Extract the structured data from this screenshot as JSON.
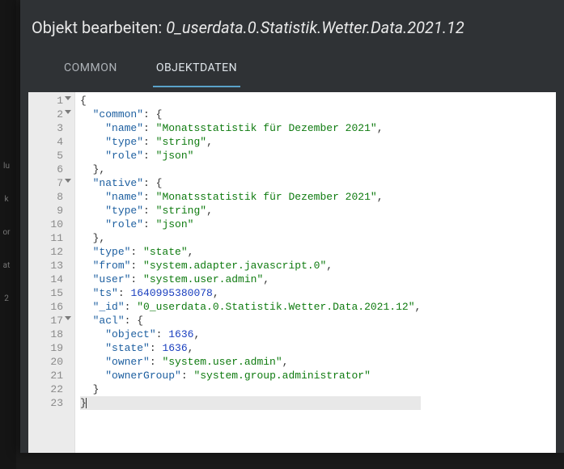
{
  "title_prefix": "Objekt bearbeiten: ",
  "object_id": "0_userdata.0.Statistik.Wetter.Data.2021.12",
  "tabs": {
    "common": "COMMON",
    "objektdaten": "OBJEKTDATEN"
  },
  "side_hints": [
    "lu",
    "k",
    "or",
    "at",
    "2"
  ],
  "editor": {
    "line_count": 23,
    "fold_lines": [
      1,
      2,
      7,
      17
    ],
    "content": {
      "common": {
        "name": "Monatsstatistik für Dezember 2021",
        "type": "string",
        "role": "json"
      },
      "native": {
        "name": "Monatsstatistik für Dezember 2021",
        "type": "string",
        "role": "json"
      },
      "type": "state",
      "from": "system.adapter.javascript.0",
      "user": "system.user.admin",
      "ts": 1640995380078,
      "_id": "0_userdata.0.Statistik.Wetter.Data.2021.12",
      "acl": {
        "object": 1636,
        "state": 1636,
        "owner": "system.user.admin",
        "ownerGroup": "system.group.administrator"
      }
    }
  }
}
